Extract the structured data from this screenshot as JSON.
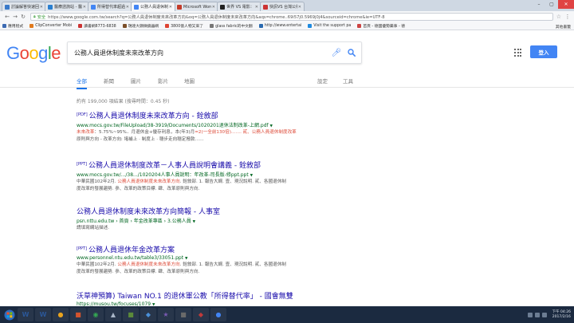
{
  "browser": {
    "tabs": [
      {
        "label": "討論解答快速回覆 - Mo",
        "color": "#3a7ac9",
        "active": false
      },
      {
        "label": "醫療諮詢站 - 醫藥工作",
        "color": "#2a7fd0",
        "active": false
      },
      {
        "label": "所得替代率超過100%",
        "color": "#4285f4",
        "active": false
      },
      {
        "label": "公務人員退休制度未來改",
        "color": "#4285f4",
        "active": true
      },
      {
        "label": "Microsoft Word - 公務",
        "color": "#c43b2a",
        "active": false
      },
      {
        "label": "世界 VS 電影：美國觀眾",
        "color": "#222222",
        "active": false
      },
      {
        "label": "快訊VS 台灣公視新聞",
        "color": "#c33",
        "active": false
      }
    ],
    "secure_label": "安全",
    "url": "https://www.google.com.tw/search?q=公務人員退休制度未來改革方向&oq=公務人員退休制度未來改革方向&aqs=chrome..69i57j0.5969j0j4&sourceid=chrome&ie=UTF-8",
    "bookmarks": [
      {
        "label": "應用程式",
        "color": "#3d6bb3"
      },
      {
        "label": "ClipConverter Mobi",
        "color": "#e07a1e"
      },
      {
        "label": "讀書網8773-6838",
        "color": "#c33"
      },
      {
        "label": "瑞達大顯微鏡器網",
        "color": "#7b4f2a"
      },
      {
        "label": "3800億人物又來了",
        "color": "#d43"
      },
      {
        "label": "glass fabric的中文翻",
        "color": "#777"
      },
      {
        "label": "http://www.entertai",
        "color": "#2a6ab0"
      },
      {
        "label": "Visit the support pa",
        "color": "#1e8ae0"
      },
      {
        "label": "首頁 - 德國優勢藥事 - 德",
        "color": "#c44"
      }
    ],
    "other_bookmarks": "其他書籤"
  },
  "google": {
    "query": "公務人員退休制度未來改革方向",
    "signin_label": "登入",
    "tabs": {
      "all": "全部",
      "news": "新聞",
      "images": "圖片",
      "videos": "影片",
      "maps": "地圖",
      "settings": "設定",
      "tools": "工具"
    },
    "stats": "約有 199,000 項結果 (搜尋時間：0.45 秒)",
    "results": [
      {
        "tag": "[PDF]",
        "title": "公務人員退休制度未來改革方向 - 銓敘部",
        "url": "www.mocs.gov.tw/FileUpload/38-3919/Documents/1020201退休法制改革-上網.pdf",
        "snippet1_a": "未來改革",
        "snippet1_b": "：5.75%~95%",
        "snippet1_c": "．月退休金+優存利息，本(年3)月",
        "snippet1_d": "=2(一全前130倍)……. 貳、公務人員退休制度改革",
        "snippet2": "原則與方向 - 改革方向: 堵補上 · 制度上 · 穩步走向穩定撥款……"
      },
      {
        "tag": "[PPT]",
        "title": "公務人員退休制度改革－人事人員說明會講義 - 銓敘部",
        "url": "www.mocs.gov.tw/.../38.../1020204人事人員說明：年改革-司長版-修ppt.ppt",
        "snippet1_a": "中華民國102年2月. ",
        "snippet1_b": "公務人員退休制度未來改革方向",
        "snippet1_c": ". 銓敘部. 1. 報告大綱. 壹、現況說明. 貳、各國退休制",
        "snippet1_d": "",
        "snippet2": "度改革的發展趨勢. 參、改革的政策目標. 肆、改革原則與方向."
      },
      {
        "tag": "",
        "title": "公務人員退休制度未來改革方向簡報 - 人事室",
        "url": "psn.nttu.edu.tw › 首頁 › 年金改革專區 › 3.公務人員",
        "snippet1_a": "請填寫網站描述.",
        "snippet1_b": "",
        "snippet1_c": "",
        "snippet1_d": "",
        "snippet2": ""
      },
      {
        "tag": "[PPT]",
        "title": "公務人員退休年金改革方案",
        "url": "www.personnel.ntu.edu.tw/table3/33051.ppt",
        "snippet1_a": "中華民國102年2月. ",
        "snippet1_b": "公務人員退休制度未來改革方向",
        "snippet1_c": ". 銓敘部. 1. 報告大綱. 壹、現況說明. 貳、各國退休制",
        "snippet1_d": "",
        "snippet2": "度改革的發展趨勢. 參、改革的政策目標. 肆、改革原則與方向."
      },
      {
        "tag": "",
        "title": "沃草神預算) Taiwan NO.1 的退休軍公教「所得替代率」 - 國會無雙",
        "url": "https://musou.tw/focuses/1079",
        "snippet1_a": "",
        "snippet1_b": "",
        "snippet1_c": "",
        "snippet1_d": "",
        "snippet2": ""
      }
    ]
  },
  "taskbar": {
    "apps": [
      {
        "icon": "W",
        "color": "#2b5797"
      },
      {
        "icon": "W",
        "color": "#2b5797"
      },
      {
        "icon": "●",
        "color": "#e8a31e"
      },
      {
        "icon": "■",
        "color": "#d4542e"
      },
      {
        "icon": "◉",
        "color": "#34a853"
      },
      {
        "icon": "▲",
        "color": "#a9b6c7"
      },
      {
        "icon": "■",
        "color": "#5b8a3a"
      },
      {
        "icon": "◆",
        "color": "#4a90d9"
      },
      {
        "icon": "★",
        "color": "#7a5ab3"
      },
      {
        "icon": "■",
        "color": "#6a6a6a"
      },
      {
        "icon": "◆",
        "color": "#c03a3a"
      },
      {
        "icon": "●",
        "color": "#4285f4"
      }
    ],
    "time": "下午 04:26",
    "date": "2017/2/16"
  }
}
